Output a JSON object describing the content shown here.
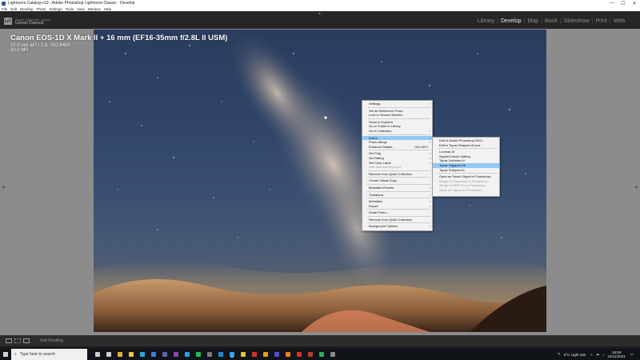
{
  "window": {
    "title": "Lightroom Catalog-v10 - Adobe Photoshop Lightroom Classic - Develop",
    "minimize": "—",
    "maximize": "☐",
    "close": "✕"
  },
  "menubar": [
    "File",
    "Edit",
    "Develop",
    "Photo",
    "Settings",
    "Tools",
    "View",
    "Window",
    "Help"
  ],
  "identity": {
    "product": "Adobe Lightroom Classic",
    "user": "Usman Dawood",
    "logo": "LrC"
  },
  "modules": [
    "Library",
    "Develop",
    "Map",
    "Book",
    "Slideshow",
    "Print",
    "Web"
  ],
  "active_module": "Develop",
  "photo_info": {
    "camera": "Canon EOS-1D X Mark II + 16 mm (EF16-35mm f/2.8L II USM)",
    "exposure": "25.0 sec at f / 2.8, ISO 6400",
    "megapixels": "20.0 MP"
  },
  "context_menu": [
    {
      "label": "Settings",
      "arrow": true
    },
    {
      "sep": true
    },
    {
      "label": "Set as Reference Photo"
    },
    {
      "label": "Lock to Second Monitor"
    },
    {
      "sep": true
    },
    {
      "label": "Show in Explorer"
    },
    {
      "label": "Go to Folder in Library"
    },
    {
      "label": "Go to Collection",
      "arrow": true
    },
    {
      "sep": true
    },
    {
      "label": "Edit In",
      "arrow": true,
      "highlight": true
    },
    {
      "label": "Photo Merge",
      "arrow": true
    },
    {
      "label": "Enhance Details...",
      "shortcut": "Ctrl+Alt+I"
    },
    {
      "sep": true
    },
    {
      "label": "Set Flag",
      "arrow": true
    },
    {
      "label": "Set Rating",
      "arrow": true
    },
    {
      "label": "Set Color Label",
      "arrow": true
    },
    {
      "label": "Add Shortcut Keyword",
      "disabled": true
    },
    {
      "sep": true
    },
    {
      "label": "Remove from Quick Collection"
    },
    {
      "sep": true
    },
    {
      "label": "Create Virtual Copy"
    },
    {
      "sep": true
    },
    {
      "label": "Metadata Presets",
      "arrow": true
    },
    {
      "sep": true
    },
    {
      "label": "Transform",
      "arrow": true
    },
    {
      "sep": true
    },
    {
      "label": "Metadata",
      "arrow": true
    },
    {
      "label": "Export",
      "arrow": true
    },
    {
      "sep": true
    },
    {
      "label": "Email Photo..."
    },
    {
      "sep": true
    },
    {
      "label": "Remove from Quick Collection"
    },
    {
      "sep": true
    },
    {
      "label": "Background Options",
      "arrow": true
    }
  ],
  "submenu": [
    {
      "label": "Edit in Adobe Photoshop 2021..."
    },
    {
      "label": "Edit in Topaz Sharpen AI.exe..."
    },
    {
      "sep": true
    },
    {
      "label": "Luminar AI"
    },
    {
      "label": "SpyderCheckr Editing"
    },
    {
      "label": "Topaz DeNoise AI"
    },
    {
      "label": "Topaz Gigapixel AI",
      "highlight": true
    },
    {
      "label": "Topaz Sharpen AI"
    },
    {
      "sep": true
    },
    {
      "label": "Open as Smart Object in Photoshop..."
    },
    {
      "label": "Merge to Panorama in Photoshop...",
      "disabled": true
    },
    {
      "label": "Merge to HDR Pro in Photoshop...",
      "disabled": true
    },
    {
      "label": "Open as Layers in Photoshop...",
      "disabled": true
    }
  ],
  "toolbar": {
    "soft_proofing": "Soft Proofing"
  },
  "taskbar": {
    "search_placeholder": "Type here to search",
    "weather": "6°C  Light rain",
    "time": "18:55",
    "date": "24/11/2021",
    "apps": [
      {
        "icon": "task-view-icon",
        "color": "#cfcfcf"
      },
      {
        "icon": "widgets-icon",
        "color": "#cfcfcf"
      },
      {
        "icon": "chrome-icon",
        "color": "#e0b12f"
      },
      {
        "icon": "file-explorer-icon",
        "color": "#f0c24a"
      },
      {
        "icon": "edge-icon",
        "color": "#2aa6d8"
      },
      {
        "icon": "mail-icon",
        "color": "#3d7fd6"
      },
      {
        "icon": "teams-icon",
        "color": "#6264a7"
      },
      {
        "icon": "onenote-icon",
        "color": "#8e44ad"
      },
      {
        "icon": "photos-icon",
        "color": "#2d9be4"
      },
      {
        "icon": "spotify-icon",
        "color": "#1db954"
      },
      {
        "icon": "media-icon",
        "color": "#7a7a7a"
      },
      {
        "icon": "photoshop-icon",
        "color": "#1c8bd6"
      },
      {
        "icon": "lightroom-classic-icon",
        "color": "#3aa0f0",
        "active": true
      },
      {
        "icon": "notes-icon",
        "color": "#e4c232"
      },
      {
        "icon": "acrobat-icon",
        "color": "#d9312a"
      },
      {
        "icon": "illustrator-icon",
        "color": "#f29b14"
      },
      {
        "icon": "premiere-icon",
        "color": "#5b4ad6"
      },
      {
        "icon": "vlc-icon",
        "color": "#ef7f1a"
      },
      {
        "icon": "opera-icon",
        "color": "#d6332a"
      },
      {
        "icon": "app-red-icon",
        "color": "#c0392b"
      },
      {
        "icon": "app-green-icon",
        "color": "#27ae60"
      },
      {
        "icon": "app-gray-icon",
        "color": "#8a8a8a"
      }
    ]
  }
}
